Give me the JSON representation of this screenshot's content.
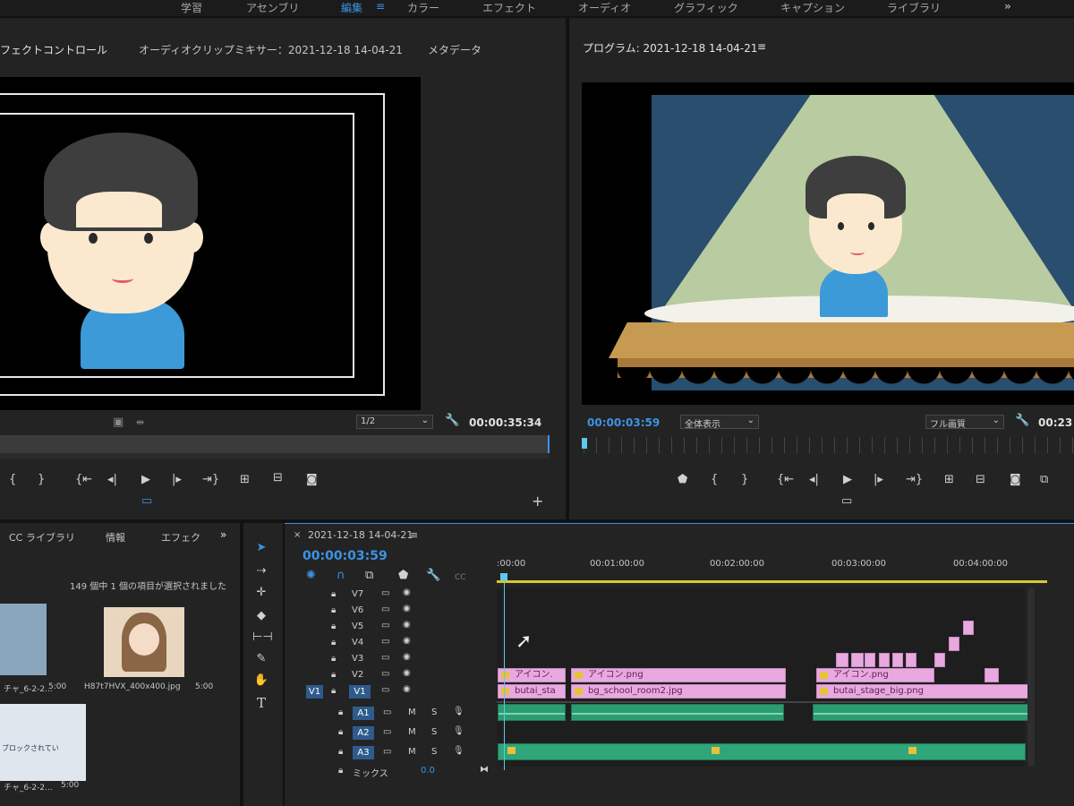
{
  "workspaces": [
    "学習",
    "アセンブリ",
    "編集",
    "カラー",
    "エフェクト",
    "オーディオ",
    "グラフィック",
    "キャプション",
    "ライブラリ"
  ],
  "workspace_more": "»",
  "source_panel": {
    "tabs": [
      "フェクトコントロール",
      "オーディオクリップミキサー：2021-12-18 14-04-21",
      "メタデータ"
    ],
    "zoom": "1/2",
    "timecode": "00:00:35:34"
  },
  "program_panel": {
    "title": "プログラム: 2021-12-18 14-04-21",
    "menu_icon": "≡",
    "timecode": "00:00:03:59",
    "fit": "全体表示",
    "quality": "フル画質",
    "duration": "00:23"
  },
  "project_panel": {
    "tabs": [
      "CC ライブラリ",
      "情報",
      "エフェク"
    ],
    "more": "»",
    "selection_status": "149 個中 1 個の項目が選択されました",
    "items": [
      {
        "name": "チャ_6-2-2...",
        "duration": "5:00"
      },
      {
        "name": "H87t7HVX_400x400.jpg",
        "duration": "5:00"
      },
      {
        "name": "チャ_6-2-2...",
        "duration": "5:00"
      }
    ],
    "blocked_text": "ブロックされてい"
  },
  "timeline": {
    "close": "×",
    "sequence_name": "2021-12-18 14-04-21",
    "menu_icon": "≡",
    "timecode": "00:00:03:59",
    "ruler": [
      ":00:00",
      "00:01:00:00",
      "00:02:00:00",
      "00:03:00:00",
      "00:04:00:00"
    ],
    "cc_label": "CC",
    "video_tracks": [
      "V7",
      "V6",
      "V5",
      "V4",
      "V3",
      "V2",
      "V1"
    ],
    "source_patch": "V1",
    "audio_tracks": [
      "A1",
      "A2",
      "A3"
    ],
    "mix_label": "ミックス",
    "mix_value": "0.0",
    "mute": "M",
    "solo": "S",
    "clips_v2": [
      "アイコン.",
      "アイコン.png",
      "アイコン.png"
    ],
    "clips_v1": [
      "butai_sta",
      "bg_school_room2.jpg",
      "butai_stage_big.png"
    ]
  },
  "colors": {
    "accent_blue": "#3c93e6",
    "video_clip": "#e7a9e0",
    "audio_clip": "#2c9c72",
    "playhead": "#5ec8f0"
  }
}
